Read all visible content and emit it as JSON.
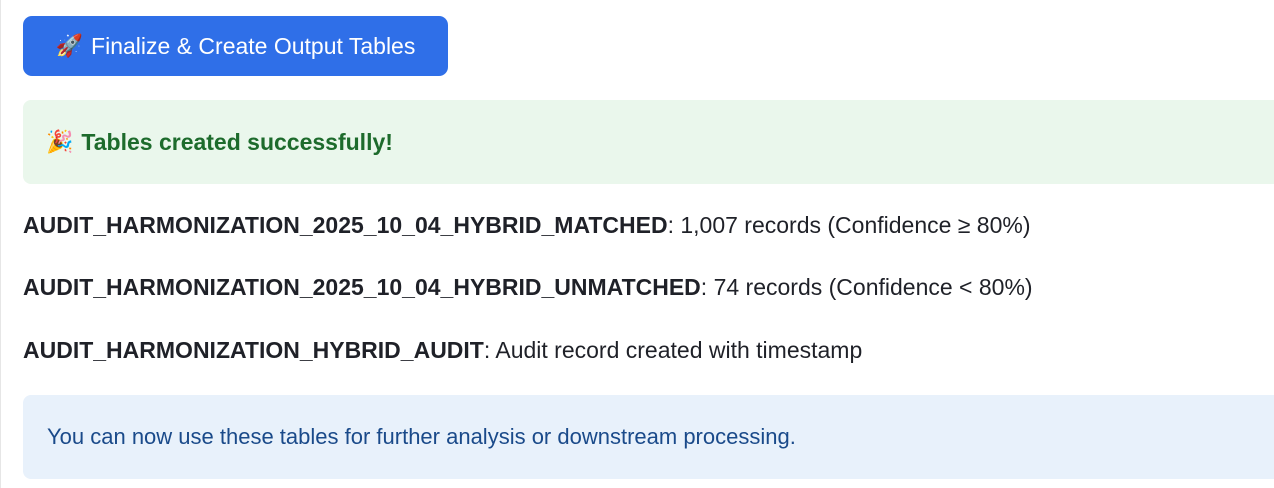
{
  "finalize_button": {
    "icon": "🚀",
    "label": "Finalize & Create Output Tables"
  },
  "success_alert": {
    "icon": "🎉",
    "text": "Tables created successfully!"
  },
  "tables": [
    {
      "name": "AUDIT_HARMONIZATION_2025_10_04_HYBRID_MATCHED",
      "description": ": 1,007 records (Confidence ≥ 80%)"
    },
    {
      "name": "AUDIT_HARMONIZATION_2025_10_04_HYBRID_UNMATCHED",
      "description": ": 74 records (Confidence < 80%)"
    },
    {
      "name": "AUDIT_HARMONIZATION_HYBRID_AUDIT",
      "description": ": Audit record created with timestamp"
    }
  ],
  "info_alert": {
    "text": "You can now use these tables for further analysis or downstream processing."
  },
  "colors": {
    "button_bg": "#2f6fe8",
    "success_bg": "#eaf7ec",
    "success_text": "#1d6b2c",
    "info_bg": "#e8f1fb",
    "info_text": "#1a4a8a"
  }
}
